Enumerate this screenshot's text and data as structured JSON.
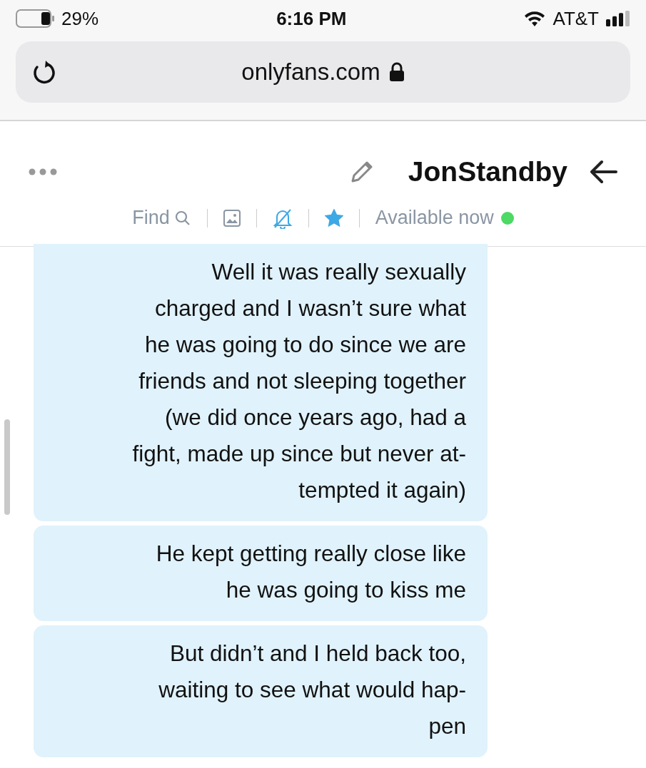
{
  "status_bar": {
    "carrier": "AT&T",
    "time": "6:16 PM",
    "battery": "29%"
  },
  "address_bar": {
    "url": "onlyfans.com"
  },
  "chat_header": {
    "name": "JonStandby",
    "status": "Available now",
    "online": true,
    "favorite": true,
    "muted": true,
    "find": "Find"
  },
  "messages": [
    {
      "text": "Well it was really sexually\ncharged and I wasn’t sure what\nhe was going to do since we are\nfriends and not sleeping together\n(we did once years ago, had a\nfight, made up since but never at-\ntempted it again)"
    },
    {
      "text": "He kept getting really close like\nhe was going to kiss me"
    },
    {
      "text": "But didn’t and I held back too,\nwaiting to see what would hap-\npen"
    }
  ]
}
